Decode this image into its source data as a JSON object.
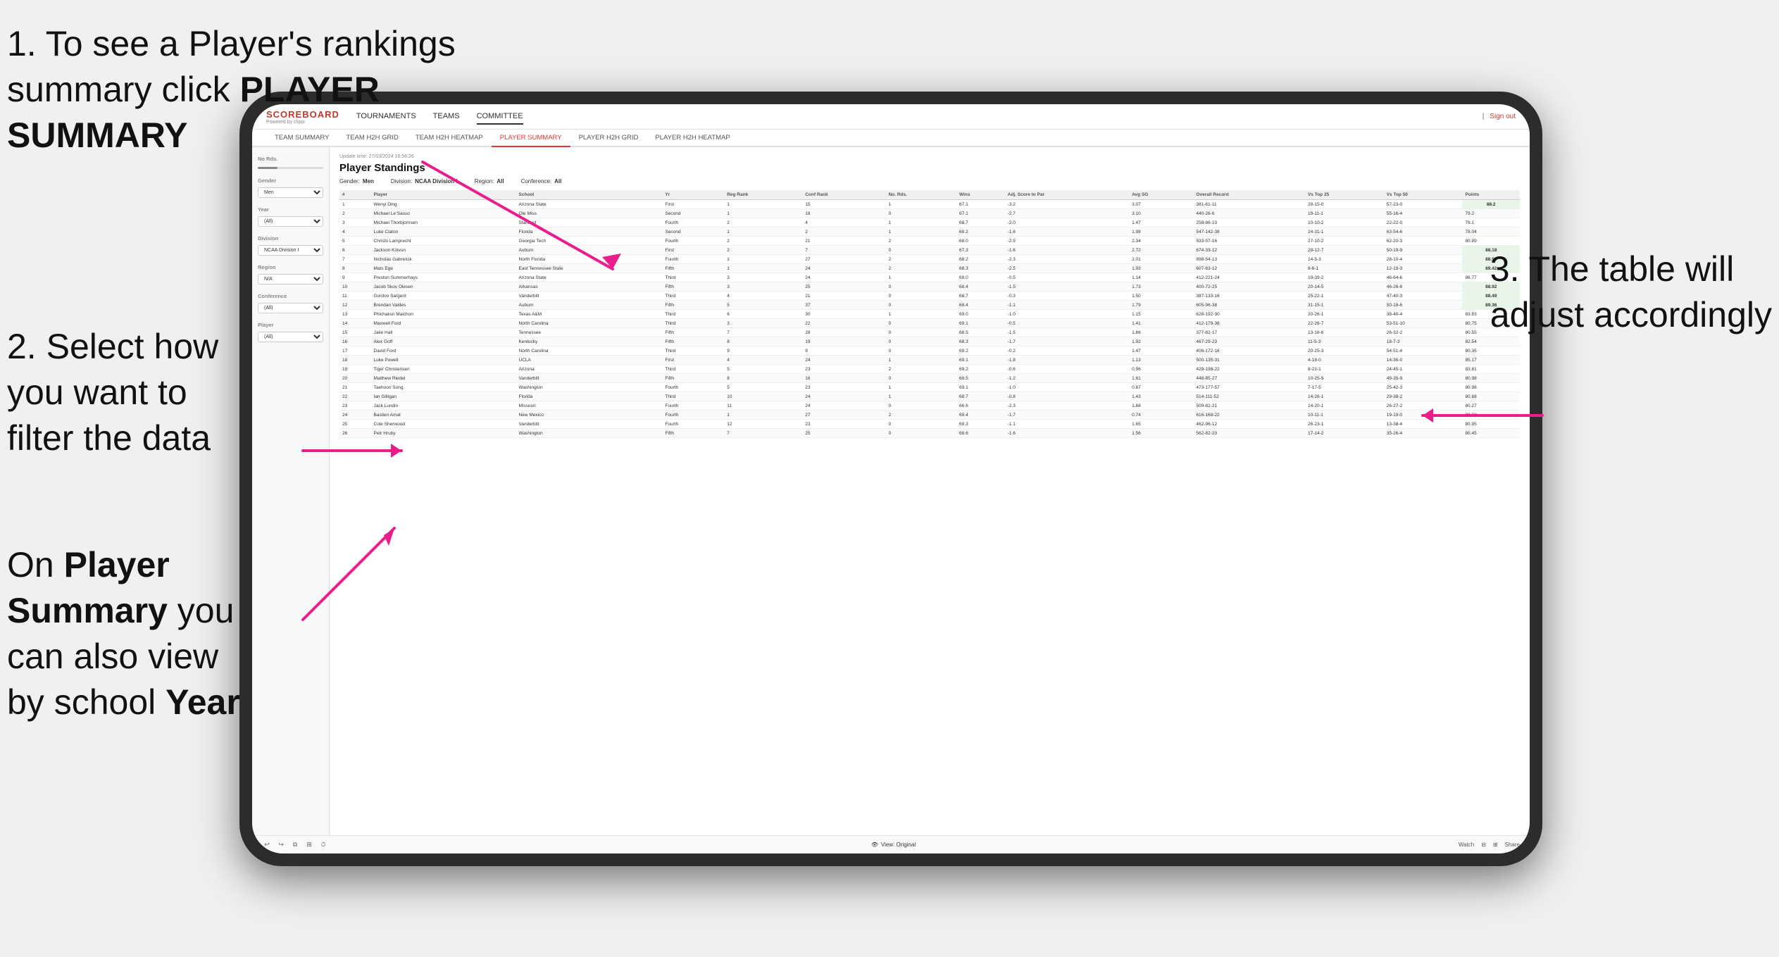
{
  "page": {
    "background": "#f0f0f0"
  },
  "annotations": {
    "annotation1": "1. To see a Player's rankings\n   summary click PLAYER\n   SUMMARY",
    "annotation1_line1": "1. To see a Player's rankings",
    "annotation1_line2": "summary click ",
    "annotation1_bold": "PLAYER",
    "annotation1_line3_bold": "SUMMARY",
    "annotation2_line1": "2. Select how",
    "annotation2_line2": "you want to",
    "annotation2_line3": "filter the data",
    "annotation3_line1": "3. The table will",
    "annotation3_line2": "adjust accordingly",
    "annotation4_line1": "On ",
    "annotation4_bold1": "Player",
    "annotation4_line2": "",
    "annotation4_bold2": "Summary",
    "annotation4_line3": " you",
    "annotation4_line4": "can also view",
    "annotation4_line5": "by school ",
    "annotation4_bold3": "Year"
  },
  "app": {
    "logo": "SCOREBOARD",
    "logo_sub": "Powered by clippi",
    "nav": {
      "items": [
        {
          "label": "TOURNAMENTS",
          "active": false
        },
        {
          "label": "TEAMS",
          "active": false
        },
        {
          "label": "COMMITTEE",
          "active": true
        }
      ],
      "sign_out": "Sign out"
    },
    "sub_nav": {
      "items": [
        {
          "label": "TEAM SUMMARY",
          "active": false
        },
        {
          "label": "TEAM H2H GRID",
          "active": false
        },
        {
          "label": "TEAM H2H HEATMAP",
          "active": false
        },
        {
          "label": "PLAYER SUMMARY",
          "active": true
        },
        {
          "label": "PLAYER H2H GRID",
          "active": false
        },
        {
          "label": "PLAYER H2H HEATMAP",
          "active": false
        }
      ]
    },
    "sidebar": {
      "no_rds_label": "No Rds.",
      "gender_label": "Gender",
      "gender_value": "Men",
      "year_label": "Year",
      "year_value": "(All)",
      "division_label": "Division",
      "division_value": "NCAA Division I",
      "region_label": "Region",
      "region_value": "N/A",
      "conference_label": "Conference",
      "conference_value": "(All)",
      "player_label": "Player",
      "player_value": "(All)"
    },
    "table": {
      "update_time": "Update time: 27/03/2024 16:56:26",
      "title": "Player Standings",
      "filters": {
        "gender_label": "Gender:",
        "gender_value": "Men",
        "division_label": "Division:",
        "division_value": "NCAA Division I",
        "region_label": "Region:",
        "region_value": "All",
        "conference_label": "Conference:",
        "conference_value": "All"
      },
      "columns": [
        "#",
        "Player",
        "School",
        "Yr",
        "Reg Rank",
        "Conf Rank",
        "No. Rds.",
        "Wins",
        "Adj. Score to Par",
        "Avg SG",
        "Overall Record",
        "Vs Top 25",
        "Vs Top 50",
        "Points"
      ],
      "rows": [
        {
          "rank": "1",
          "player": "Wenyi Ding",
          "school": "Arizona State",
          "yr": "First",
          "reg_rank": "1",
          "conf_rank": "15",
          "no_rds": "1",
          "wins": "67.1",
          "adj": "-3.2",
          "avg_sg": "3.07",
          "record": "381-61-11",
          "top25": "28-15-0",
          "top50": "57-23-0",
          "points": "88.2"
        },
        {
          "rank": "2",
          "player": "Michael Le Sasso",
          "school": "Ole Miss",
          "yr": "Second",
          "reg_rank": "1",
          "conf_rank": "18",
          "no_rds": "0",
          "wins": "67.1",
          "adj": "-2.7",
          "avg_sg": "3.10",
          "record": "440-26-6",
          "top25": "19-11-1",
          "top50": "55-16-4",
          "points": "79.2"
        },
        {
          "rank": "3",
          "player": "Michael Thorbjornsen",
          "school": "Stanford",
          "yr": "Fourth",
          "reg_rank": "2",
          "conf_rank": "4",
          "no_rds": "1",
          "wins": "68.7",
          "adj": "-2.0",
          "avg_sg": "1.47",
          "record": "258-86-13",
          "top25": "10-10-2",
          "top50": "22-22-0",
          "points": "79.1"
        },
        {
          "rank": "4",
          "player": "Luke Claton",
          "school": "Florida",
          "yr": "Second",
          "reg_rank": "1",
          "conf_rank": "2",
          "no_rds": "1",
          "wins": "68.2",
          "adj": "-1.6",
          "avg_sg": "1.98",
          "record": "547-142-38",
          "top25": "24-31-1",
          "top50": "63-54-6",
          "points": "78.04"
        },
        {
          "rank": "5",
          "player": "Christo Lamprecht",
          "school": "Georgia Tech",
          "yr": "Fourth",
          "reg_rank": "2",
          "conf_rank": "21",
          "no_rds": "2",
          "wins": "68.0",
          "adj": "-2.5",
          "avg_sg": "2.34",
          "record": "533-57-16",
          "top25": "27-10-2",
          "top50": "62-20-3",
          "points": "80.89"
        },
        {
          "rank": "6",
          "player": "Jackson Koivun",
          "school": "Auburn",
          "yr": "First",
          "reg_rank": "2",
          "conf_rank": "7",
          "no_rds": "0",
          "wins": "67.3",
          "adj": "-1.6",
          "avg_sg": "2.72",
          "record": "674-33-12",
          "top25": "28-12-7",
          "top50": "50-19-9",
          "points": "88.18"
        },
        {
          "rank": "7",
          "player": "Nicholas Gabrelcik",
          "school": "North Florida",
          "yr": "Fourth",
          "reg_rank": "1",
          "conf_rank": "27",
          "no_rds": "2",
          "wins": "68.2",
          "adj": "-2.3",
          "avg_sg": "2.01",
          "record": "898-54-13",
          "top25": "14-5-3",
          "top50": "28-10-4",
          "points": "88.56"
        },
        {
          "rank": "8",
          "player": "Mats Ege",
          "school": "East Tennessee State",
          "yr": "Fifth",
          "reg_rank": "1",
          "conf_rank": "24",
          "no_rds": "2",
          "wins": "68.3",
          "adj": "-2.5",
          "avg_sg": "1.93",
          "record": "607-63-12",
          "top25": "8-6-1",
          "top50": "12-19-3",
          "points": "89.42"
        },
        {
          "rank": "9",
          "player": "Preston Summerhays",
          "school": "Arizona State",
          "yr": "Third",
          "reg_rank": "3",
          "conf_rank": "24",
          "no_rds": "1",
          "wins": "69.0",
          "adj": "-0.5",
          "avg_sg": "1.14",
          "record": "412-221-24",
          "top25": "19-39-2",
          "top50": "46-64-6",
          "points": "86.77"
        },
        {
          "rank": "10",
          "player": "Jacob Skov Olesen",
          "school": "Arkansas",
          "yr": "Fifth",
          "reg_rank": "3",
          "conf_rank": "25",
          "no_rds": "0",
          "wins": "68.4",
          "adj": "-1.5",
          "avg_sg": "1.73",
          "record": "400-72-25",
          "top25": "20-14-5",
          "top50": "46-26-6",
          "points": "88.92"
        },
        {
          "rank": "11",
          "player": "Gordon Sargent",
          "school": "Vanderbilt",
          "yr": "Third",
          "reg_rank": "4",
          "conf_rank": "21",
          "no_rds": "0",
          "wins": "68.7",
          "adj": "-0.3",
          "avg_sg": "1.50",
          "record": "387-133-16",
          "top25": "25-22-1",
          "top50": "47-40-3",
          "points": "88.49"
        },
        {
          "rank": "12",
          "player": "Brendan Valdes",
          "school": "Auburn",
          "yr": "Fifth",
          "reg_rank": "5",
          "conf_rank": "37",
          "no_rds": "0",
          "wins": "68.4",
          "adj": "-1.1",
          "avg_sg": "1.79",
          "record": "605-96-38",
          "top25": "31-15-1",
          "top50": "50-18-6",
          "points": "89.36"
        },
        {
          "rank": "13",
          "player": "Phichaksn Maichon",
          "school": "Texas A&M",
          "yr": "Third",
          "reg_rank": "6",
          "conf_rank": "30",
          "no_rds": "1",
          "wins": "69.0",
          "adj": "-1.0",
          "avg_sg": "1.15",
          "record": "628-192-30",
          "top25": "20-26-1",
          "top50": "38-40-4",
          "points": "83.83"
        },
        {
          "rank": "14",
          "player": "Maxwell Ford",
          "school": "North Carolina",
          "yr": "Third",
          "reg_rank": "3",
          "conf_rank": "22",
          "no_rds": "0",
          "wins": "69.1",
          "adj": "-0.5",
          "avg_sg": "1.41",
          "record": "412-179-38",
          "top25": "22-26-7",
          "top50": "53-51-10",
          "points": "80.75"
        },
        {
          "rank": "15",
          "player": "Jake Hall",
          "school": "Tennessee",
          "yr": "Fifth",
          "reg_rank": "7",
          "conf_rank": "28",
          "no_rds": "0",
          "wins": "68.5",
          "adj": "-1.5",
          "avg_sg": "1.66",
          "record": "377-82-17",
          "top25": "13-18-6",
          "top50": "26-32-2",
          "points": "80.55"
        },
        {
          "rank": "16",
          "player": "Alex Goff",
          "school": "Kentucky",
          "yr": "Fifth",
          "reg_rank": "8",
          "conf_rank": "19",
          "no_rds": "0",
          "wins": "68.3",
          "adj": "-1.7",
          "avg_sg": "1.92",
          "record": "467-29-23",
          "top25": "11-5-3",
          "top50": "18-7-3",
          "points": "82.54"
        },
        {
          "rank": "17",
          "player": "David Ford",
          "school": "North Carolina",
          "yr": "Third",
          "reg_rank": "9",
          "conf_rank": "9",
          "no_rds": "0",
          "wins": "69.2",
          "adj": "-0.2",
          "avg_sg": "1.47",
          "record": "406-172-16",
          "top25": "20-25-3",
          "top50": "54-51-4",
          "points": "80.35"
        },
        {
          "rank": "18",
          "player": "Luke Powell",
          "school": "UCLA",
          "yr": "First",
          "reg_rank": "4",
          "conf_rank": "24",
          "no_rds": "1",
          "wins": "69.1",
          "adj": "-1.8",
          "avg_sg": "1.13",
          "record": "500-135-31",
          "top25": "4-18-0",
          "top50": "14-36-0",
          "points": "85.17"
        },
        {
          "rank": "19",
          "player": "Tiger Christensen",
          "school": "Arizona",
          "yr": "Third",
          "reg_rank": "5",
          "conf_rank": "23",
          "no_rds": "2",
          "wins": "69.2",
          "adj": "-0.6",
          "avg_sg": "0.96",
          "record": "429-198-22",
          "top25": "8-21-1",
          "top50": "24-45-1",
          "points": "83.81"
        },
        {
          "rank": "20",
          "player": "Matthew Riedel",
          "school": "Vanderbilt",
          "yr": "Fifth",
          "reg_rank": "8",
          "conf_rank": "16",
          "no_rds": "0",
          "wins": "68.5",
          "adj": "-1.2",
          "avg_sg": "1.61",
          "record": "448-85-27",
          "top25": "10-25-9",
          "top50": "49-35-9",
          "points": "80.98"
        },
        {
          "rank": "21",
          "player": "Taehoon Song",
          "school": "Washington",
          "yr": "Fourth",
          "reg_rank": "5",
          "conf_rank": "23",
          "no_rds": "1",
          "wins": "69.1",
          "adj": "-1.0",
          "avg_sg": "0.87",
          "record": "473-177-57",
          "top25": "7-17-5",
          "top50": "25-42-3",
          "points": "80.98"
        },
        {
          "rank": "22",
          "player": "Ian Gilligan",
          "school": "Florida",
          "yr": "Third",
          "reg_rank": "10",
          "conf_rank": "24",
          "no_rds": "1",
          "wins": "68.7",
          "adj": "-0.8",
          "avg_sg": "1.43",
          "record": "514-111-52",
          "top25": "14-26-1",
          "top50": "29-38-2",
          "points": "80.68"
        },
        {
          "rank": "23",
          "player": "Jack Lundin",
          "school": "Missouri",
          "yr": "Fourth",
          "reg_rank": "11",
          "conf_rank": "24",
          "no_rds": "0",
          "wins": "66.6",
          "adj": "-2.3",
          "avg_sg": "1.68",
          "record": "509-82-21",
          "top25": "14-20-1",
          "top50": "26-27-2",
          "points": "80.27"
        },
        {
          "rank": "24",
          "player": "Bastien Amat",
          "school": "New Mexico",
          "yr": "Fourth",
          "reg_rank": "1",
          "conf_rank": "27",
          "no_rds": "2",
          "wins": "69.4",
          "adj": "-1.7",
          "avg_sg": "0.74",
          "record": "616-168-22",
          "top25": "10-11-1",
          "top50": "19-19-0",
          "points": "80.02"
        },
        {
          "rank": "25",
          "player": "Cole Sherwood",
          "school": "Vanderbilt",
          "yr": "Fourth",
          "reg_rank": "12",
          "conf_rank": "23",
          "no_rds": "0",
          "wins": "69.3",
          "adj": "-1.1",
          "avg_sg": "1.65",
          "record": "462-96-12",
          "top25": "26-23-1",
          "top50": "13-38-4",
          "points": "80.95"
        },
        {
          "rank": "26",
          "player": "Petr Hruby",
          "school": "Washington",
          "yr": "Fifth",
          "reg_rank": "7",
          "conf_rank": "25",
          "no_rds": "0",
          "wins": "68.6",
          "adj": "-1.6",
          "avg_sg": "1.56",
          "record": "562-82-23",
          "top25": "17-14-2",
          "top50": "35-26-4",
          "points": "80.45"
        }
      ]
    },
    "toolbar": {
      "view_label": "View: Original",
      "watch_label": "Watch",
      "share_label": "Share"
    }
  }
}
